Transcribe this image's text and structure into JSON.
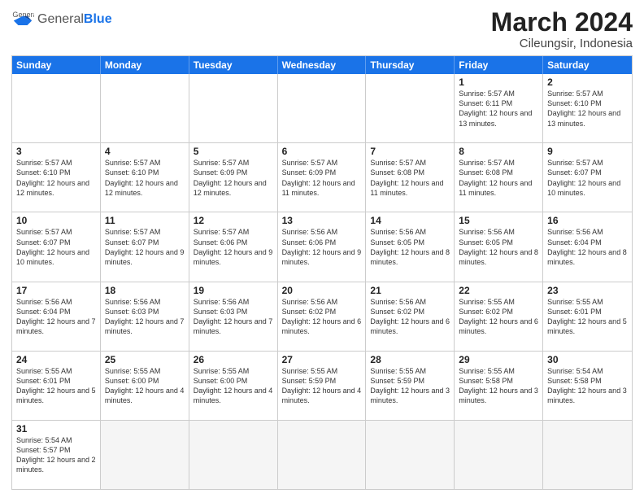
{
  "header": {
    "logo_general": "General",
    "logo_blue": "Blue",
    "month_year": "March 2024",
    "location": "Cileungsir, Indonesia"
  },
  "days_of_week": [
    "Sunday",
    "Monday",
    "Tuesday",
    "Wednesday",
    "Thursday",
    "Friday",
    "Saturday"
  ],
  "weeks": [
    [
      {
        "day": "",
        "info": ""
      },
      {
        "day": "",
        "info": ""
      },
      {
        "day": "",
        "info": ""
      },
      {
        "day": "",
        "info": ""
      },
      {
        "day": "",
        "info": ""
      },
      {
        "day": "1",
        "info": "Sunrise: 5:57 AM\nSunset: 6:11 PM\nDaylight: 12 hours and 13 minutes."
      },
      {
        "day": "2",
        "info": "Sunrise: 5:57 AM\nSunset: 6:10 PM\nDaylight: 12 hours and 13 minutes."
      }
    ],
    [
      {
        "day": "3",
        "info": "Sunrise: 5:57 AM\nSunset: 6:10 PM\nDaylight: 12 hours and 12 minutes."
      },
      {
        "day": "4",
        "info": "Sunrise: 5:57 AM\nSunset: 6:10 PM\nDaylight: 12 hours and 12 minutes."
      },
      {
        "day": "5",
        "info": "Sunrise: 5:57 AM\nSunset: 6:09 PM\nDaylight: 12 hours and 12 minutes."
      },
      {
        "day": "6",
        "info": "Sunrise: 5:57 AM\nSunset: 6:09 PM\nDaylight: 12 hours and 11 minutes."
      },
      {
        "day": "7",
        "info": "Sunrise: 5:57 AM\nSunset: 6:08 PM\nDaylight: 12 hours and 11 minutes."
      },
      {
        "day": "8",
        "info": "Sunrise: 5:57 AM\nSunset: 6:08 PM\nDaylight: 12 hours and 11 minutes."
      },
      {
        "day": "9",
        "info": "Sunrise: 5:57 AM\nSunset: 6:07 PM\nDaylight: 12 hours and 10 minutes."
      }
    ],
    [
      {
        "day": "10",
        "info": "Sunrise: 5:57 AM\nSunset: 6:07 PM\nDaylight: 12 hours and 10 minutes."
      },
      {
        "day": "11",
        "info": "Sunrise: 5:57 AM\nSunset: 6:07 PM\nDaylight: 12 hours and 9 minutes."
      },
      {
        "day": "12",
        "info": "Sunrise: 5:57 AM\nSunset: 6:06 PM\nDaylight: 12 hours and 9 minutes."
      },
      {
        "day": "13",
        "info": "Sunrise: 5:56 AM\nSunset: 6:06 PM\nDaylight: 12 hours and 9 minutes."
      },
      {
        "day": "14",
        "info": "Sunrise: 5:56 AM\nSunset: 6:05 PM\nDaylight: 12 hours and 8 minutes."
      },
      {
        "day": "15",
        "info": "Sunrise: 5:56 AM\nSunset: 6:05 PM\nDaylight: 12 hours and 8 minutes."
      },
      {
        "day": "16",
        "info": "Sunrise: 5:56 AM\nSunset: 6:04 PM\nDaylight: 12 hours and 8 minutes."
      }
    ],
    [
      {
        "day": "17",
        "info": "Sunrise: 5:56 AM\nSunset: 6:04 PM\nDaylight: 12 hours and 7 minutes."
      },
      {
        "day": "18",
        "info": "Sunrise: 5:56 AM\nSunset: 6:03 PM\nDaylight: 12 hours and 7 minutes."
      },
      {
        "day": "19",
        "info": "Sunrise: 5:56 AM\nSunset: 6:03 PM\nDaylight: 12 hours and 7 minutes."
      },
      {
        "day": "20",
        "info": "Sunrise: 5:56 AM\nSunset: 6:02 PM\nDaylight: 12 hours and 6 minutes."
      },
      {
        "day": "21",
        "info": "Sunrise: 5:56 AM\nSunset: 6:02 PM\nDaylight: 12 hours and 6 minutes."
      },
      {
        "day": "22",
        "info": "Sunrise: 5:55 AM\nSunset: 6:02 PM\nDaylight: 12 hours and 6 minutes."
      },
      {
        "day": "23",
        "info": "Sunrise: 5:55 AM\nSunset: 6:01 PM\nDaylight: 12 hours and 5 minutes."
      }
    ],
    [
      {
        "day": "24",
        "info": "Sunrise: 5:55 AM\nSunset: 6:01 PM\nDaylight: 12 hours and 5 minutes."
      },
      {
        "day": "25",
        "info": "Sunrise: 5:55 AM\nSunset: 6:00 PM\nDaylight: 12 hours and 4 minutes."
      },
      {
        "day": "26",
        "info": "Sunrise: 5:55 AM\nSunset: 6:00 PM\nDaylight: 12 hours and 4 minutes."
      },
      {
        "day": "27",
        "info": "Sunrise: 5:55 AM\nSunset: 5:59 PM\nDaylight: 12 hours and 4 minutes."
      },
      {
        "day": "28",
        "info": "Sunrise: 5:55 AM\nSunset: 5:59 PM\nDaylight: 12 hours and 3 minutes."
      },
      {
        "day": "29",
        "info": "Sunrise: 5:55 AM\nSunset: 5:58 PM\nDaylight: 12 hours and 3 minutes."
      },
      {
        "day": "30",
        "info": "Sunrise: 5:54 AM\nSunset: 5:58 PM\nDaylight: 12 hours and 3 minutes."
      }
    ],
    [
      {
        "day": "31",
        "info": "Sunrise: 5:54 AM\nSunset: 5:57 PM\nDaylight: 12 hours and 2 minutes."
      },
      {
        "day": "",
        "info": ""
      },
      {
        "day": "",
        "info": ""
      },
      {
        "day": "",
        "info": ""
      },
      {
        "day": "",
        "info": ""
      },
      {
        "day": "",
        "info": ""
      },
      {
        "day": "",
        "info": ""
      }
    ]
  ]
}
